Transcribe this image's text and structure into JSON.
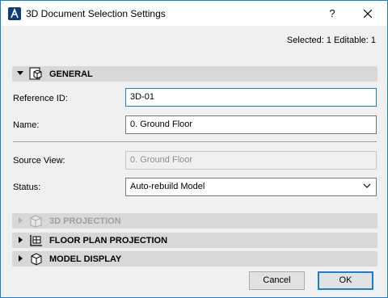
{
  "window": {
    "title": "3D Document Selection Settings",
    "help_label": "?",
    "close_icon": "close-icon",
    "accent_color": "#1a7fd4"
  },
  "selection": {
    "summary": "Selected: 1 Editable: 1"
  },
  "panels": {
    "general": {
      "label": "GENERAL",
      "expanded": true,
      "icon": "3d-document-icon"
    },
    "projection_3d": {
      "label": "3D PROJECTION",
      "expanded": false,
      "enabled": false,
      "icon": "3d-projection-icon"
    },
    "floor_plan_projection": {
      "label": "FLOOR PLAN PROJECTION",
      "expanded": false,
      "icon": "floor-plan-icon"
    },
    "model_display": {
      "label": "MODEL DISPLAY",
      "expanded": false,
      "icon": "model-cube-icon"
    }
  },
  "general": {
    "reference_id_label": "Reference ID:",
    "reference_id_value": "3D-01",
    "name_label": "Name:",
    "name_value": "0. Ground Floor",
    "source_view_label": "Source View:",
    "source_view_value": "0. Ground Floor",
    "status_label": "Status:",
    "status_value": "Auto-rebuild Model"
  },
  "footer": {
    "cancel_label": "Cancel",
    "ok_label": "OK"
  }
}
